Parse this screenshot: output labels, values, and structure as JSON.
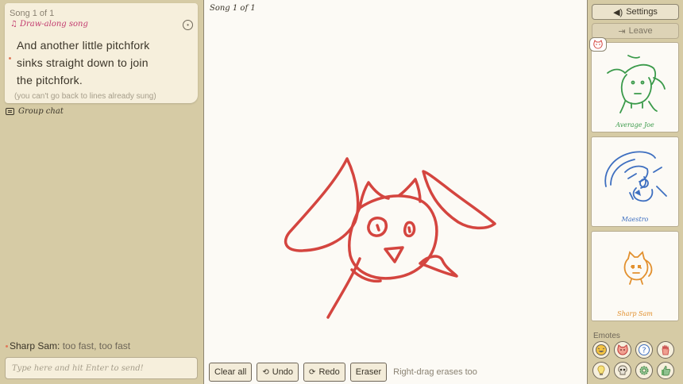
{
  "song": {
    "counter": "Song 1 of 1",
    "mode_label": "Draw-along song",
    "lyrics": [
      "And another little pitchfork",
      "sinks straight down to join",
      "the pitchfork."
    ],
    "hint": "(you can't go back to lines already sung)"
  },
  "chat": {
    "title": "Group chat",
    "messages": [
      {
        "author": "Sharp Sam",
        "separator": ":",
        "text": " too fast, too fast"
      }
    ],
    "input_placeholder": "Type here and hit Enter to send!"
  },
  "canvas": {
    "label": "Song 1 of 1",
    "stroke_color": "#d4453f"
  },
  "toolbar": {
    "clear_label": "Clear all",
    "undo_label": "Undo",
    "redo_label": "Redo",
    "eraser_label": "Eraser",
    "hint": "Right-drag erases too"
  },
  "sidebar": {
    "settings_label": "Settings",
    "leave_label": "Leave",
    "players": [
      {
        "name": "Average Joe",
        "color": "#3a9a4a"
      },
      {
        "name": "Maestro",
        "color": "#3e6fc0"
      },
      {
        "name": "Sharp Sam",
        "color": "#e2902e"
      }
    ],
    "emotes_label": "Emotes",
    "emotes": [
      "laugh-icon",
      "cat-face-icon",
      "question-icon",
      "raised-hand-icon",
      "lightbulb-icon",
      "skull-icon",
      "gear-icon",
      "thumbs-up-icon"
    ]
  }
}
